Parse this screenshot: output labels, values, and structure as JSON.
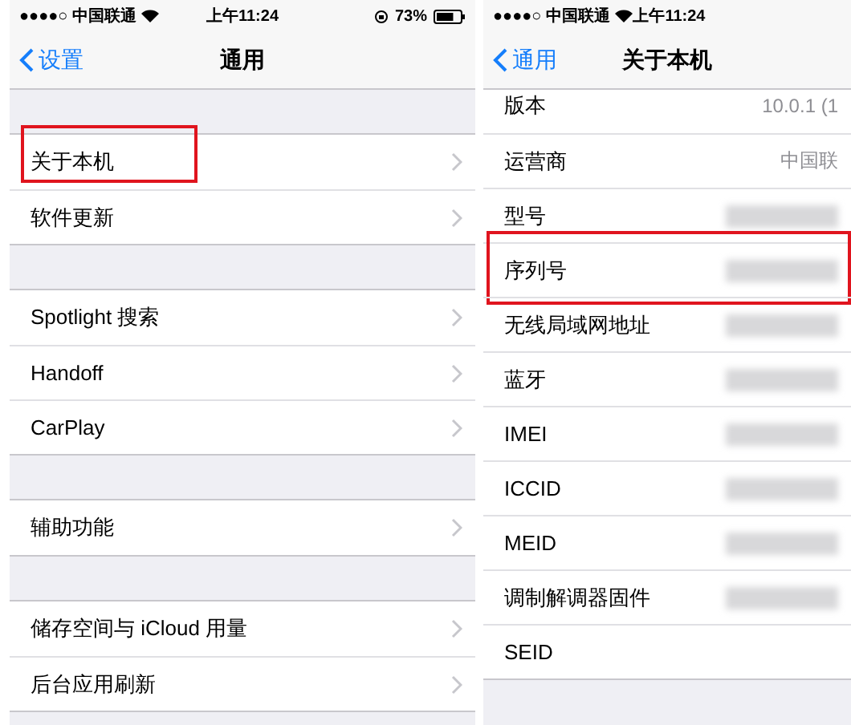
{
  "screens": [
    {
      "status_bar": {
        "signal": "●●●●○",
        "carrier": "中国联通",
        "time": "上午11:24",
        "battery": "73%"
      },
      "nav": {
        "back": "设置",
        "title": "通用"
      },
      "scrolled": false,
      "groups": [
        {
          "rows": [
            {
              "label": "关于本机",
              "chevron": true,
              "highlighted": true
            },
            {
              "label": "软件更新",
              "chevron": true,
              "highlighted": false
            }
          ]
        },
        {
          "rows": [
            {
              "label": "Spotlight 搜索",
              "chevron": true,
              "highlighted": false
            },
            {
              "label": "Handoff",
              "chevron": true,
              "highlighted": false
            },
            {
              "label": "CarPlay",
              "chevron": true,
              "highlighted": false
            }
          ]
        },
        {
          "rows": [
            {
              "label": "辅助功能",
              "chevron": true,
              "highlighted": false
            }
          ]
        },
        {
          "rows": [
            {
              "label": "储存空间与 iCloud 用量",
              "chevron": true,
              "highlighted": false
            },
            {
              "label": "后台应用刷新",
              "chevron": true,
              "highlighted": false
            }
          ]
        }
      ]
    },
    {
      "status_bar": {
        "signal": "●●●●○",
        "carrier": "中国联通",
        "time": "上午11:24"
      },
      "nav": {
        "back": "通用",
        "title": "关于本机"
      },
      "scrolled": true,
      "groups": [
        {
          "rows": [
            {
              "label": "版本",
              "value": "10.0.1 (1",
              "highlighted": false
            },
            {
              "label": "运营商",
              "value": "中国联",
              "highlighted": false
            },
            {
              "label": "型号",
              "redacted": true,
              "highlighted": false
            },
            {
              "label": "序列号",
              "redacted": true,
              "highlighted": true
            },
            {
              "label": "无线局域网地址",
              "redacted": true,
              "highlighted": false
            },
            {
              "label": "蓝牙",
              "redacted": true,
              "highlighted": false
            },
            {
              "label": "IMEI",
              "redacted": true,
              "highlighted": false
            },
            {
              "label": "ICCID",
              "redacted": true,
              "highlighted": false
            },
            {
              "label": "MEID",
              "redacted": true,
              "highlighted": false
            },
            {
              "label": "调制解调器固件",
              "redacted": true,
              "highlighted": false
            },
            {
              "label": "SEID",
              "highlighted": false
            }
          ]
        }
      ]
    }
  ]
}
